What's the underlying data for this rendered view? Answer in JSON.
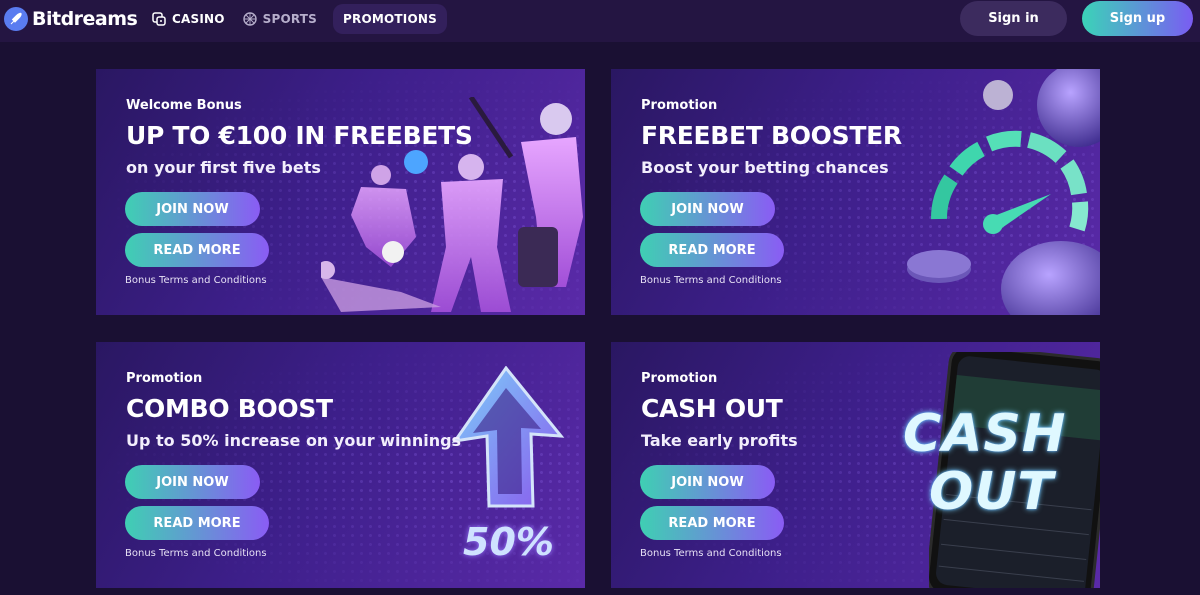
{
  "header": {
    "logo_text": "Bitdreams",
    "nav": [
      {
        "label": "CASINO",
        "icon": "dice-icon"
      },
      {
        "label": "SPORTS",
        "icon": "ball-icon"
      },
      {
        "label": "PROMOTIONS",
        "active": true
      }
    ],
    "signin_label": "Sign in",
    "signup_label": "Sign up"
  },
  "promos": [
    {
      "label": "Welcome Bonus",
      "title": "UP TO €100 IN FREEBETS",
      "subtitle": "on your first five bets",
      "join_label": "JOIN NOW",
      "read_label": "READ MORE",
      "terms": "Bonus Terms and Conditions"
    },
    {
      "label": "Promotion",
      "title": "FREEBET BOOSTER",
      "subtitle": "Boost your betting chances",
      "join_label": "JOIN NOW",
      "read_label": "READ MORE",
      "terms": "Bonus Terms and Conditions"
    },
    {
      "label": "Promotion",
      "title": "COMBO BOOST",
      "subtitle": "Up to 50% increase on your winnings",
      "join_label": "JOIN NOW",
      "read_label": "READ MORE",
      "terms": "Bonus Terms and Conditions",
      "graphic_text": "50%"
    },
    {
      "label": "Promotion",
      "title": "CASH OUT",
      "subtitle": "Take early profits",
      "join_label": "JOIN NOW",
      "read_label": "READ MORE",
      "terms": "Bonus Terms and Conditions",
      "graphic_text_1": "CASH",
      "graphic_text_2": "OUT"
    }
  ],
  "colors": {
    "background": "#1a1033",
    "header": "#241542",
    "card": "#3d1f8a",
    "accent_teal": "#3fcfb3",
    "accent_purple": "#8a5cf4"
  }
}
